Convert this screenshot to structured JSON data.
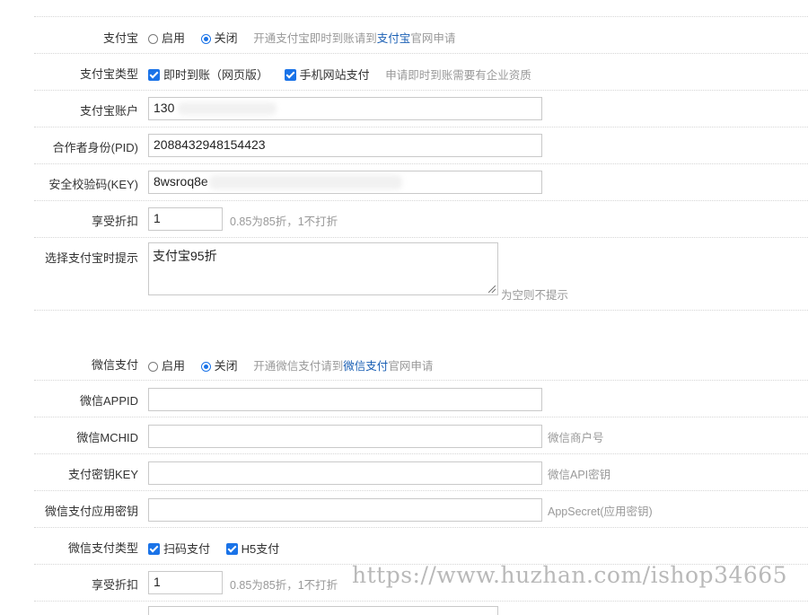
{
  "alipay": {
    "enable": {
      "label": "支付宝",
      "on": "启用",
      "off": "关闭",
      "note_prefix": "开通支付宝即时到账请到",
      "note_link": "支付宝",
      "note_suffix": "官网申请"
    },
    "type": {
      "label": "支付宝类型",
      "opt1": "即时到账（网页版）",
      "opt2": "手机网站支付",
      "note": "申请即时到账需要有企业资质"
    },
    "account": {
      "label": "支付宝账户",
      "value": "130"
    },
    "pid": {
      "label": "合作者身份(PID)",
      "value": "2088432948154423"
    },
    "key": {
      "label": "安全校验码(KEY)",
      "value": "8wsroq8e"
    },
    "discount": {
      "label": "享受折扣",
      "value": "1",
      "note": "0.85为85折，1不打折"
    },
    "tip": {
      "label": "选择支付宝时提示",
      "value": "支付宝95折",
      "note": "为空则不提示"
    }
  },
  "wechat": {
    "enable": {
      "label": "微信支付",
      "on": "启用",
      "off": "关闭",
      "note_prefix": "开通微信支付请到",
      "note_link": "微信支付",
      "note_suffix": "官网申请"
    },
    "appid": {
      "label": "微信APPID",
      "value": ""
    },
    "mchid": {
      "label": "微信MCHID",
      "value": "",
      "note": "微信商户号"
    },
    "key": {
      "label": "支付密钥KEY",
      "value": "",
      "note": "微信API密钥"
    },
    "secret": {
      "label": "微信支付应用密钥",
      "value": "",
      "note": "AppSecret(应用密钥)"
    },
    "type": {
      "label": "微信支付类型",
      "opt1": "扫码支付",
      "opt2": "H5支付"
    },
    "discount": {
      "label": "享受折扣",
      "value": "1",
      "note": "0.85为85折，1不打折"
    }
  },
  "watermark": "https://www.huzhan.com/ishop34665",
  "colors": {
    "accent": "#1a73e8",
    "link": "#1a5fb4",
    "hint": "#999999"
  }
}
